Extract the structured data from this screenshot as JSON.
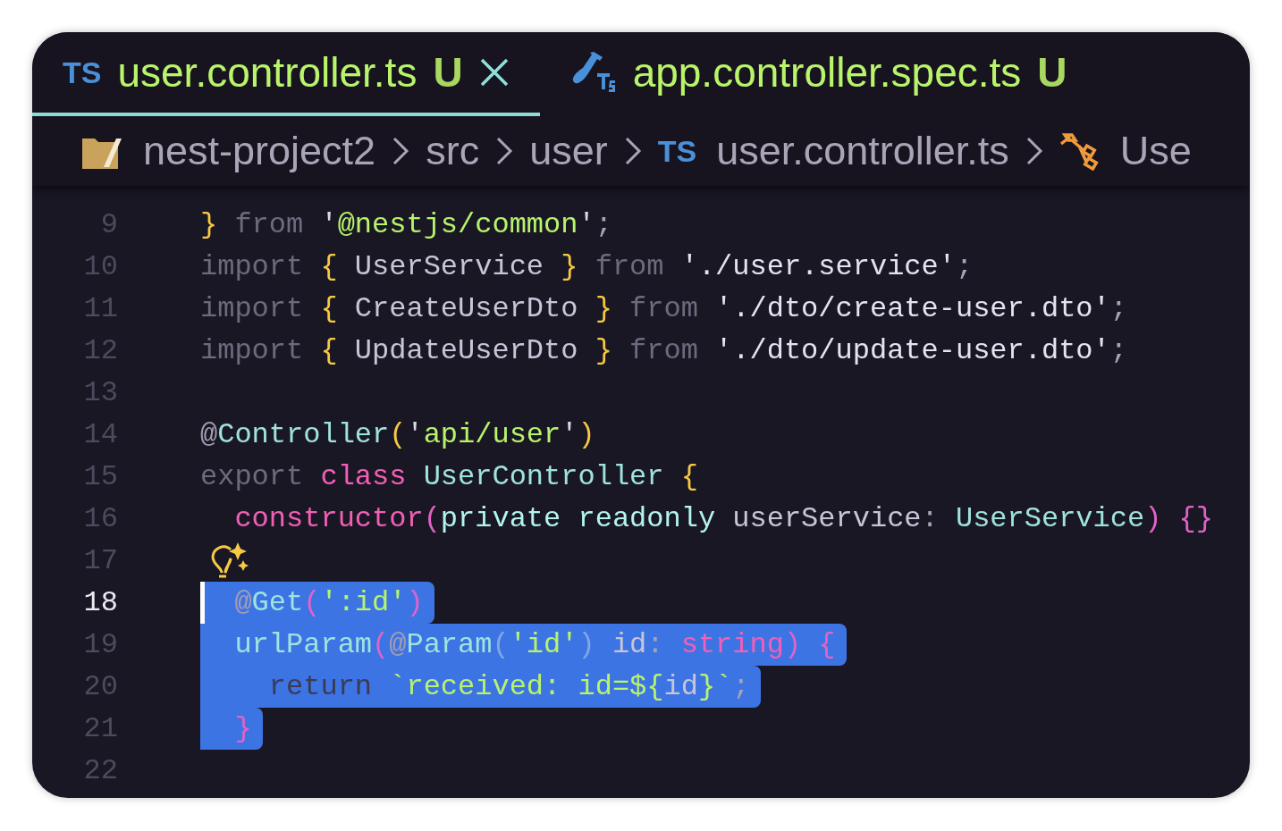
{
  "tabs": [
    {
      "kind": "ts",
      "icon_text": "TS",
      "label": "user.controller.ts",
      "status": "U",
      "selected": true,
      "closable": true
    },
    {
      "kind": "test",
      "label": "app.controller.spec.ts",
      "status": "U",
      "selected": false,
      "closable": false
    }
  ],
  "breadcrumb": [
    {
      "kind": "project",
      "label": "nest-project2"
    },
    {
      "kind": "plain",
      "label": "src"
    },
    {
      "kind": "plain",
      "label": "user"
    },
    {
      "kind": "file",
      "icon_text": "TS",
      "label": "user.controller.ts"
    },
    {
      "kind": "class",
      "label": "Use"
    }
  ],
  "lines": [
    {
      "number": "9",
      "selected": false,
      "current": false,
      "lightbulb": false,
      "tokens": [
        {
          "text": "}",
          "kind": "brace"
        },
        {
          "text": " from ",
          "kind": "keyword"
        },
        {
          "text": "'",
          "kind": "quote"
        },
        {
          "text": "@nestjs/common",
          "kind": "string"
        },
        {
          "text": "'",
          "kind": "quote"
        },
        {
          "text": ";",
          "kind": "punct"
        }
      ]
    },
    {
      "number": "10",
      "selected": false,
      "current": false,
      "lightbulb": false,
      "tokens": [
        {
          "text": "import ",
          "kind": "keyword"
        },
        {
          "text": "{ ",
          "kind": "brace"
        },
        {
          "text": "UserService ",
          "kind": "plain"
        },
        {
          "text": "} ",
          "kind": "brace"
        },
        {
          "text": "from ",
          "kind": "keyword"
        },
        {
          "text": "'./user.service'",
          "kind": "path"
        },
        {
          "text": ";",
          "kind": "punct"
        }
      ]
    },
    {
      "number": "11",
      "selected": false,
      "current": false,
      "lightbulb": false,
      "tokens": [
        {
          "text": "import ",
          "kind": "keyword"
        },
        {
          "text": "{ ",
          "kind": "brace"
        },
        {
          "text": "CreateUserDto ",
          "kind": "plain"
        },
        {
          "text": "} ",
          "kind": "brace"
        },
        {
          "text": "from ",
          "kind": "keyword"
        },
        {
          "text": "'./dto/create-user.dto'",
          "kind": "path"
        },
        {
          "text": ";",
          "kind": "punct"
        }
      ]
    },
    {
      "number": "12",
      "selected": false,
      "current": false,
      "lightbulb": false,
      "tokens": [
        {
          "text": "import ",
          "kind": "keyword"
        },
        {
          "text": "{ ",
          "kind": "brace"
        },
        {
          "text": "UpdateUserDto ",
          "kind": "plain"
        },
        {
          "text": "} ",
          "kind": "brace"
        },
        {
          "text": "from ",
          "kind": "keyword"
        },
        {
          "text": "'./dto/update-user.dto'",
          "kind": "path"
        },
        {
          "text": ";",
          "kind": "punct"
        }
      ]
    },
    {
      "number": "13",
      "selected": false,
      "current": false,
      "lightbulb": false
    },
    {
      "number": "14",
      "selected": false,
      "current": false,
      "lightbulb": false,
      "tokens": [
        {
          "text": "@",
          "kind": "at"
        },
        {
          "text": "Controller",
          "kind": "type"
        },
        {
          "text": "(",
          "kind": "brace"
        },
        {
          "text": "'",
          "kind": "quote"
        },
        {
          "text": "api/user",
          "kind": "string"
        },
        {
          "text": "'",
          "kind": "quote"
        },
        {
          "text": ")",
          "kind": "brace"
        }
      ]
    },
    {
      "number": "15",
      "selected": false,
      "current": false,
      "lightbulb": false,
      "tokens": [
        {
          "text": "export ",
          "kind": "keyword"
        },
        {
          "text": "class ",
          "kind": "storage"
        },
        {
          "text": "UserController ",
          "kind": "type"
        },
        {
          "text": "{",
          "kind": "brace"
        }
      ]
    },
    {
      "number": "16",
      "selected": false,
      "current": false,
      "lightbulb": false,
      "tokens": [
        {
          "text": "  constructor",
          "kind": "storage"
        },
        {
          "text": "(",
          "kind": "paren"
        },
        {
          "text": "private readonly ",
          "kind": "modifier"
        },
        {
          "text": "userService",
          "kind": "plain"
        },
        {
          "text": ": ",
          "kind": "punct"
        },
        {
          "text": "UserService",
          "kind": "type"
        },
        {
          "text": ") {}",
          "kind": "paren"
        }
      ]
    },
    {
      "number": "17",
      "selected": false,
      "current": false,
      "lightbulb": true
    },
    {
      "number": "18",
      "selected": true,
      "current": true,
      "lightbulb": false,
      "tokens": [
        {
          "text": "  @",
          "kind": "at"
        },
        {
          "text": "Get",
          "kind": "type"
        },
        {
          "text": "(",
          "kind": "paren"
        },
        {
          "text": "':id'",
          "kind": "string"
        },
        {
          "text": ")",
          "kind": "paren"
        }
      ]
    },
    {
      "number": "19",
      "selected": true,
      "current": false,
      "lightbulb": false,
      "tokens": [
        {
          "text": "  urlParam",
          "kind": "type"
        },
        {
          "text": "(",
          "kind": "paren"
        },
        {
          "text": "@",
          "kind": "at"
        },
        {
          "text": "Param",
          "kind": "type"
        },
        {
          "text": "(",
          "kind": "paren2"
        },
        {
          "text": "'id'",
          "kind": "string"
        },
        {
          "text": ")",
          "kind": "paren2"
        },
        {
          "text": " id",
          "kind": "plain"
        },
        {
          "text": ": ",
          "kind": "punct"
        },
        {
          "text": "string",
          "kind": "storage"
        },
        {
          "text": ") {",
          "kind": "paren"
        }
      ]
    },
    {
      "number": "20",
      "selected": true,
      "current": false,
      "lightbulb": false,
      "tokens": [
        {
          "text": "    return ",
          "kind": "keyword"
        },
        {
          "text": "`received: id=${",
          "kind": "string"
        },
        {
          "text": "id",
          "kind": "plain"
        },
        {
          "text": "}`",
          "kind": "string"
        },
        {
          "text": ";",
          "kind": "punct"
        }
      ]
    },
    {
      "number": "21",
      "selected": true,
      "current": false,
      "lightbulb": false,
      "tokens": [
        {
          "text": "  }",
          "kind": "paren"
        }
      ]
    },
    {
      "number": "22",
      "selected": false,
      "current": false,
      "lightbulb": false
    }
  ]
}
